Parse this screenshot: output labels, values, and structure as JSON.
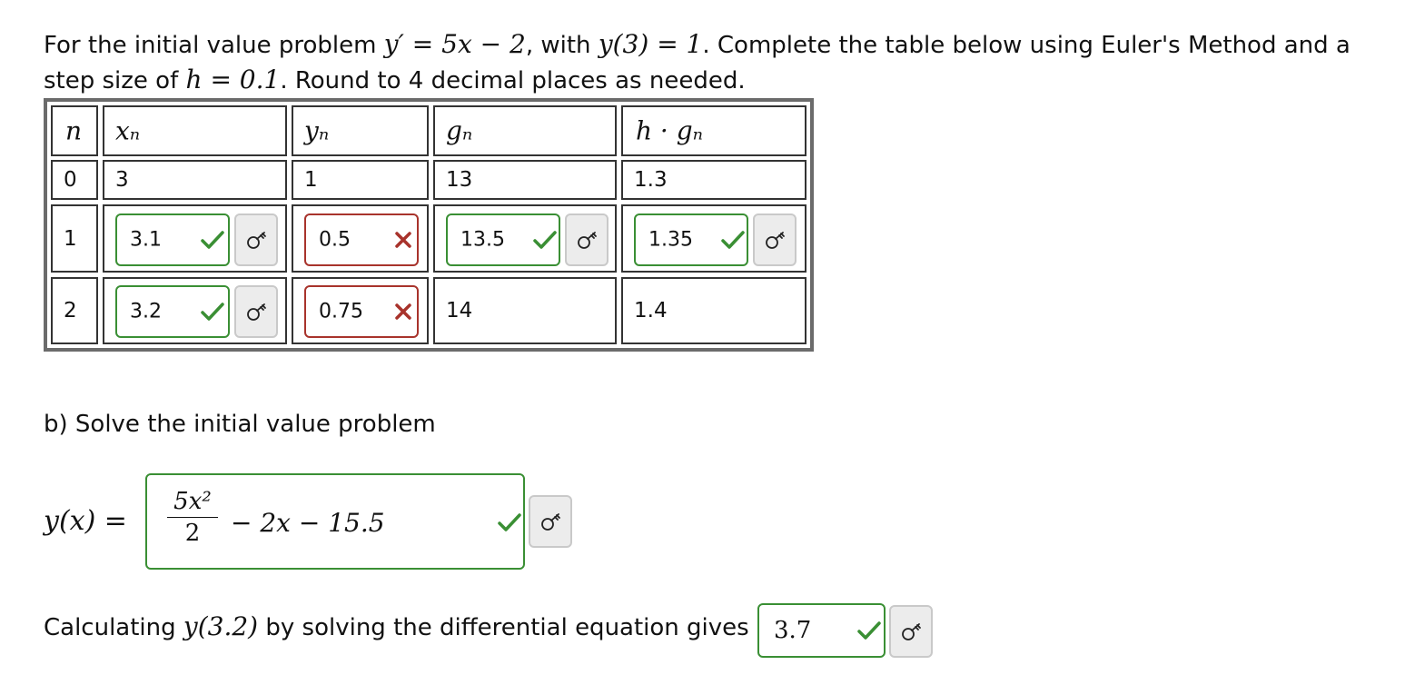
{
  "intro": {
    "pre": "For the initial value problem ",
    "ode": "y′ = 5x − 2",
    "mid1": ", with ",
    "ic": "y(3) = 1",
    "mid2": ". Complete the table below using Euler's Method and a step size of ",
    "h_expr": "h = 0.1",
    "post": ". Round to 4 decimal places as needed."
  },
  "table": {
    "headers": [
      "n",
      "xₙ",
      "yₙ",
      "gₙ",
      "h · gₙ"
    ],
    "row0": {
      "n": "0",
      "x": "3",
      "y": "1",
      "g": "13",
      "hg": "1.3"
    },
    "row1": {
      "n": "1",
      "x": "3.1",
      "y": "0.5",
      "g": "13.5",
      "hg": "1.35"
    },
    "row2": {
      "n": "2",
      "x": "3.2",
      "y": "0.75",
      "g": "14",
      "hg": "1.4"
    }
  },
  "part_b": {
    "label": "b) Solve the initial value problem",
    "lhs": "y(x) =",
    "frac_num": "5x²",
    "frac_den": "2",
    "expr_rest": "− 2x − 15.5"
  },
  "calc": {
    "pre": "Calculating ",
    "expr": "y(3.2)",
    "post": " by solving the differential equation gives",
    "value": "3.7"
  },
  "icons": {
    "correct": "check-icon",
    "incorrect": "x-icon",
    "key": "key-icon"
  },
  "colors": {
    "correct": "#3a8f34",
    "incorrect": "#a8332c",
    "key_button_bg": "#ececec"
  }
}
